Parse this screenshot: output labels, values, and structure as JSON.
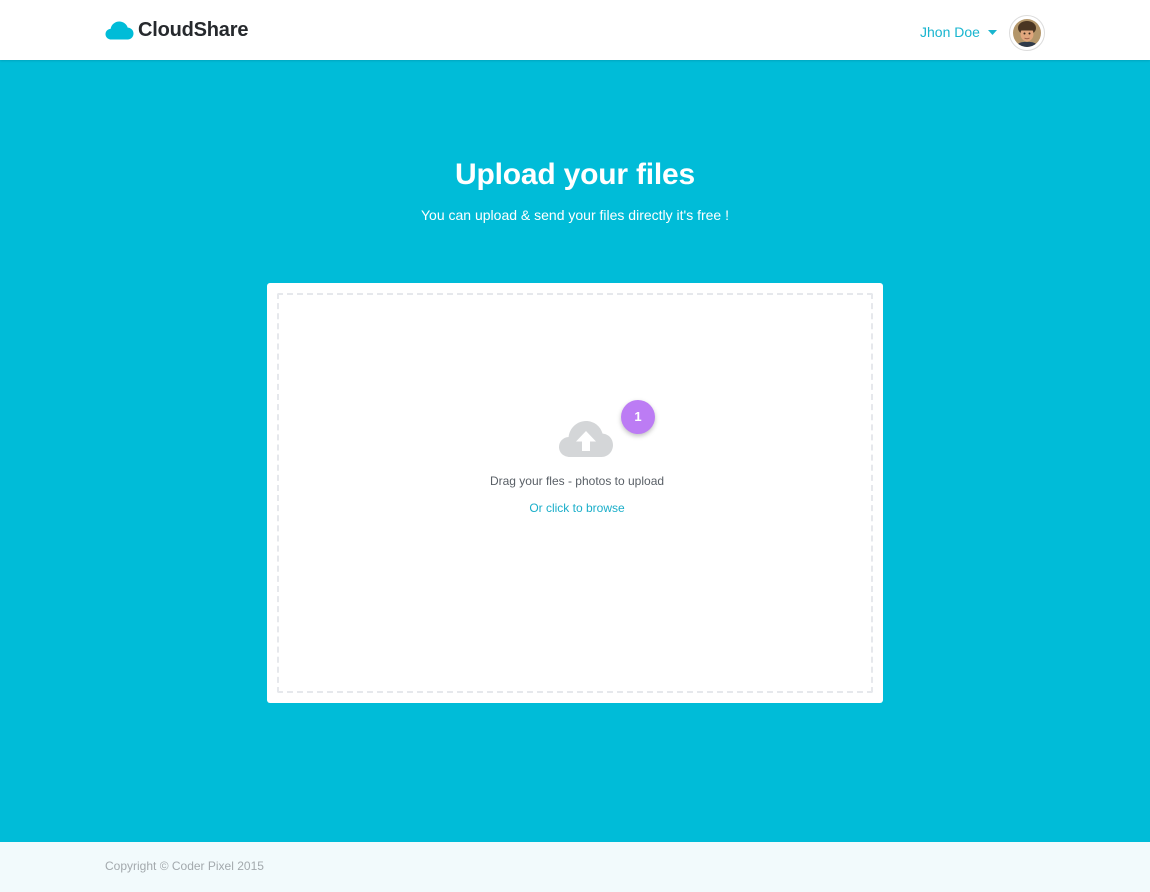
{
  "header": {
    "brand": "CloudShare",
    "user_name": "Jhon Doe",
    "icons": {
      "logo": "cloud-icon",
      "user_menu": "chevron-down-icon",
      "avatar": "user-avatar"
    }
  },
  "hero": {
    "title": "Upload your files",
    "subtitle": "You can upload & send your files directly it's free !"
  },
  "upload": {
    "badge_count": "1",
    "drop_text": "Drag your fles - photos to upload",
    "browse_label": "Or click to browse",
    "icon": "cloud-upload-icon"
  },
  "footer": {
    "copyright": "Copyright © Coder Pixel 2015"
  },
  "colors": {
    "accent": "#00bcd8",
    "brand_text": "#26292d",
    "link": "#1aaec9",
    "badge": "#bc7cf4",
    "footer_bg": "#f2fafc"
  }
}
